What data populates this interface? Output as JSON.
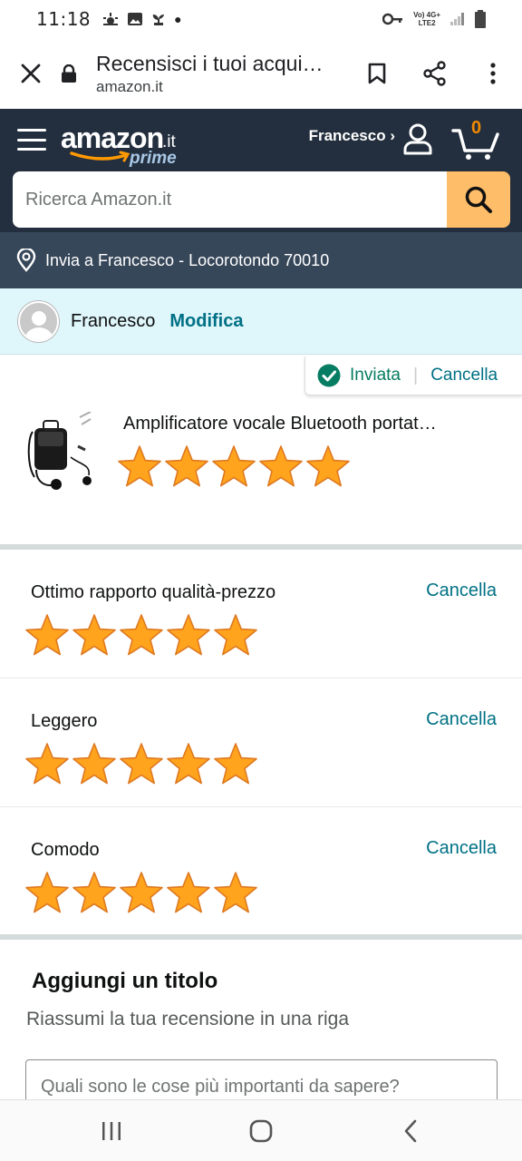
{
  "status_bar": {
    "time": "11:18",
    "network_top": "Vo) 4G+",
    "network_bottom": "LTE2"
  },
  "browser": {
    "page_title": "Recensisci i tuoi acqui…",
    "domain": "amazon.it"
  },
  "header": {
    "logo_word": "amazon",
    "logo_tld": ".it",
    "logo_prime": "prime",
    "account_label": "Francesco ›",
    "cart_count": "0",
    "search_placeholder": "Ricerca Amazon.it",
    "deliver_to": "Invia a Francesco - Locorotondo 70010"
  },
  "profile": {
    "name": "Francesco",
    "edit_label": "Modifica"
  },
  "status_chip": {
    "sent_label": "Inviata",
    "separator": "|",
    "cancel_label": "Cancella"
  },
  "product": {
    "title": "Amplificatore vocale Bluetooth portat…",
    "rating": 5,
    "max_rating": 5
  },
  "attributes": [
    {
      "label": "Ottimo rapporto qualità-prezzo",
      "cancel_label": "Cancella",
      "rating": 5
    },
    {
      "label": "Leggero",
      "cancel_label": "Cancella",
      "rating": 5
    },
    {
      "label": "Comodo",
      "cancel_label": "Cancella",
      "rating": 5
    }
  ],
  "title_section": {
    "heading": "Aggiungi un titolo",
    "subheading": "Riassumi la tua recensione in una riga",
    "input_placeholder": "Quali sono le cose più importanti da sapere?"
  },
  "colors": {
    "header_bg": "#232f3e",
    "deliver_bg": "#37475a",
    "search_button": "#febd69",
    "link": "#007185",
    "star": "#ffa41c",
    "profile_bg": "#dff6fb"
  },
  "icons": {
    "close": "close-icon",
    "lock": "lock-icon",
    "bookmark": "bookmark-icon",
    "share": "share-icon",
    "more": "more-vert-icon",
    "menu": "hamburger-icon",
    "account": "account-icon",
    "cart": "cart-icon",
    "search": "search-icon",
    "location": "location-pin-icon",
    "check": "check-circle-icon"
  }
}
